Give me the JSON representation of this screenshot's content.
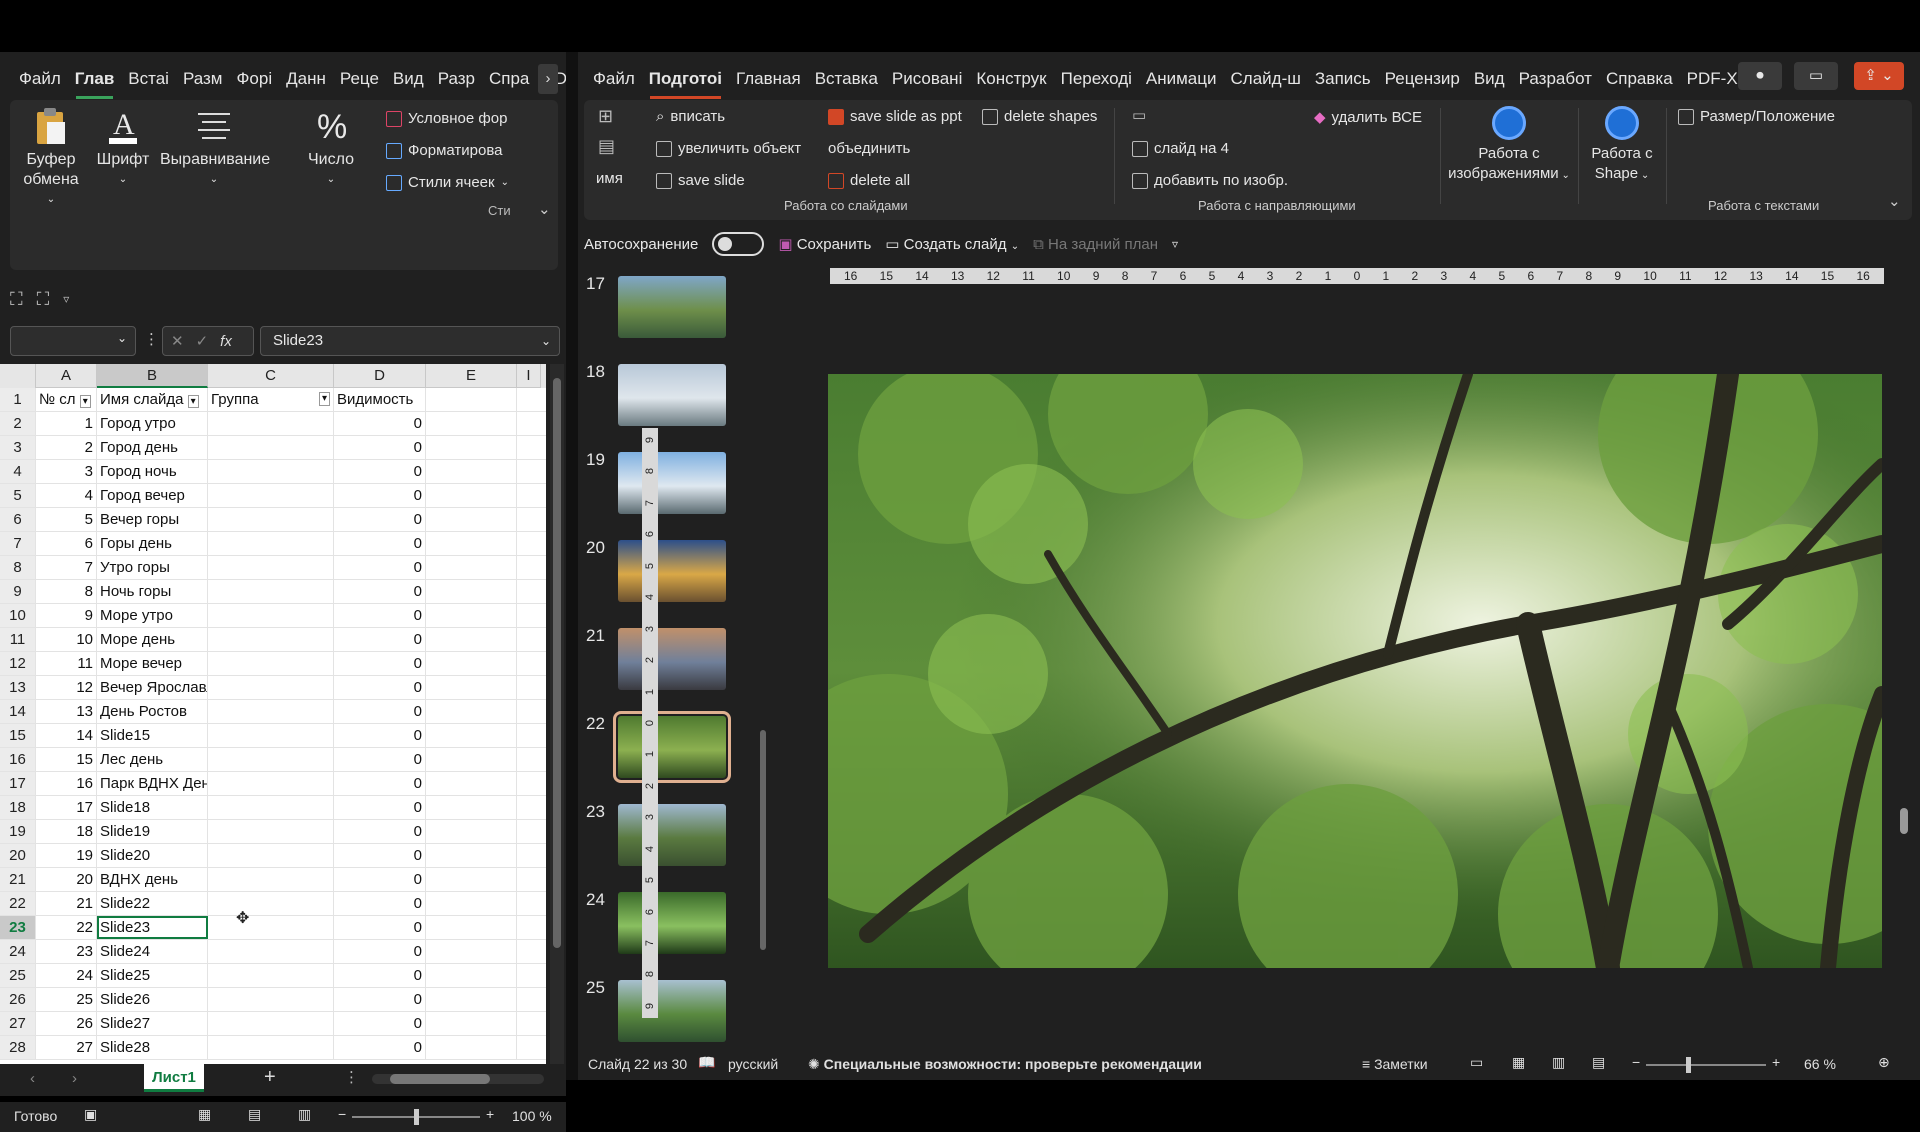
{
  "excel": {
    "tabs": [
      "Файл",
      "Глав",
      "Встаі",
      "Разм",
      "Форі",
      "Данн",
      "Реце",
      "Вид",
      "Разр",
      "Спра",
      "PDF-"
    ],
    "active_tab": "Глав",
    "ribbon": {
      "clipboard": "Буфер\nобмена",
      "font": "Шрифт",
      "align": "Выравнивание",
      "number": "Число",
      "cond_format": "Условное фор",
      "format_table": "Форматирова",
      "cell_styles": "Стили ячеек",
      "styles_group": "Сти"
    },
    "formula_bar": {
      "content": "Slide23",
      "fx": "fx"
    },
    "columns": [
      "A",
      "B",
      "C",
      "D",
      "E",
      "I"
    ],
    "headers": [
      "№ сл",
      "Имя слайда",
      "Группа",
      "Видимость"
    ],
    "rows": [
      {
        "n": "2",
        "a": "1",
        "b": "Город утро",
        "d": "0"
      },
      {
        "n": "3",
        "a": "2",
        "b": "Город день",
        "d": "0"
      },
      {
        "n": "4",
        "a": "3",
        "b": "Город ночь",
        "d": "0"
      },
      {
        "n": "5",
        "a": "4",
        "b": "Город вечер",
        "d": "0"
      },
      {
        "n": "6",
        "a": "5",
        "b": "Вечер горы",
        "d": "0"
      },
      {
        "n": "7",
        "a": "6",
        "b": "Горы день",
        "d": "0"
      },
      {
        "n": "8",
        "a": "7",
        "b": "Утро горы",
        "d": "0"
      },
      {
        "n": "9",
        "a": "8",
        "b": "Ночь горы",
        "d": "0"
      },
      {
        "n": "10",
        "a": "9",
        "b": "Море утро",
        "d": "0"
      },
      {
        "n": "11",
        "a": "10",
        "b": "Море день",
        "d": "0"
      },
      {
        "n": "12",
        "a": "11",
        "b": "Море вечер",
        "d": "0"
      },
      {
        "n": "13",
        "a": "12",
        "b": "Вечер Ярославль",
        "d": "0"
      },
      {
        "n": "14",
        "a": "13",
        "b": "День Ростов",
        "d": "0"
      },
      {
        "n": "15",
        "a": "14",
        "b": "Slide15",
        "d": "0"
      },
      {
        "n": "16",
        "a": "15",
        "b": "Лес день",
        "d": "0"
      },
      {
        "n": "17",
        "a": "16",
        "b": "Парк ВДНХ День",
        "d": "0"
      },
      {
        "n": "18",
        "a": "17",
        "b": "Slide18",
        "d": "0"
      },
      {
        "n": "19",
        "a": "18",
        "b": "Slide19",
        "d": "0"
      },
      {
        "n": "20",
        "a": "19",
        "b": "Slide20",
        "d": "0"
      },
      {
        "n": "21",
        "a": "20",
        "b": "ВДНХ день",
        "d": "0"
      },
      {
        "n": "22",
        "a": "21",
        "b": "Slide22",
        "d": "0"
      },
      {
        "n": "23",
        "a": "22",
        "b": "Slide23",
        "d": "0"
      },
      {
        "n": "24",
        "a": "23",
        "b": "Slide24",
        "d": "0"
      },
      {
        "n": "25",
        "a": "24",
        "b": "Slide25",
        "d": "0"
      },
      {
        "n": "26",
        "a": "25",
        "b": "Slide26",
        "d": "0"
      },
      {
        "n": "27",
        "a": "26",
        "b": "Slide27",
        "d": "0"
      },
      {
        "n": "28",
        "a": "27",
        "b": "Slide28",
        "d": "0"
      }
    ],
    "sheet_tab": "Лист1",
    "status": {
      "ready": "Готово",
      "zoom": "100 %"
    }
  },
  "ppt": {
    "tabs": [
      "Файл",
      "Подготоі",
      "Главная",
      "Вставка",
      "Рисовані",
      "Конструк",
      "Переході",
      "Анимаци",
      "Слайд-ш",
      "Запись",
      "Рецензир",
      "Вид",
      "Разработ",
      "Справка",
      "PDF-XCh"
    ],
    "active_tab": "Подготоі",
    "ribbon": {
      "fit": "вписать",
      "enlarge": "увеличить объект",
      "save_slide": "save slide",
      "save_ppt": "save slide as ppt",
      "merge": "объединить",
      "delete_all": "delete all",
      "delete_shapes": "delete shapes",
      "name": "имя",
      "group_slides": "Работа со слайдами",
      "slide_on_4": "слайд на 4",
      "add_by_image": "добавить по изобр.",
      "group_guides": "Работа с направляющими",
      "delete_all_ru": "удалить ВСЕ",
      "images": "Работа с\nизображениями",
      "shape": "Работа с\nShape",
      "size_pos": "Размер/Положение",
      "group_texts": "Работа с текстами"
    },
    "qat": {
      "autosave": "Автосохранение",
      "save": "Сохранить",
      "new_slide": "Создать слайд",
      "send_back": "На задний план"
    },
    "thumbnails": [
      "17",
      "18",
      "19",
      "20",
      "21",
      "22",
      "23",
      "24",
      "25"
    ],
    "selected_thumb": "22",
    "ruler_h": [
      "16",
      "15",
      "14",
      "13",
      "12",
      "11",
      "10",
      "9",
      "8",
      "7",
      "6",
      "5",
      "4",
      "3",
      "2",
      "1",
      "0",
      "1",
      "2",
      "3",
      "4",
      "5",
      "6",
      "7",
      "8",
      "9",
      "10",
      "11",
      "12",
      "13",
      "14",
      "15",
      "16"
    ],
    "ruler_v": [
      "9",
      "8",
      "7",
      "6",
      "5",
      "4",
      "3",
      "2",
      "1",
      "0",
      "1",
      "2",
      "3",
      "4",
      "5",
      "6",
      "7",
      "8",
      "9"
    ],
    "status": {
      "slide": "Слайд 22 из 30",
      "lang": "русский",
      "accessibility": "Специальные возможности: проверьте рекомендации",
      "notes": "Заметки",
      "zoom": "66 %"
    }
  },
  "colors": {
    "accent_excel": "#3aa35c",
    "accent_ppt": "#d24726",
    "circle_blue": "#1f6fd6"
  }
}
